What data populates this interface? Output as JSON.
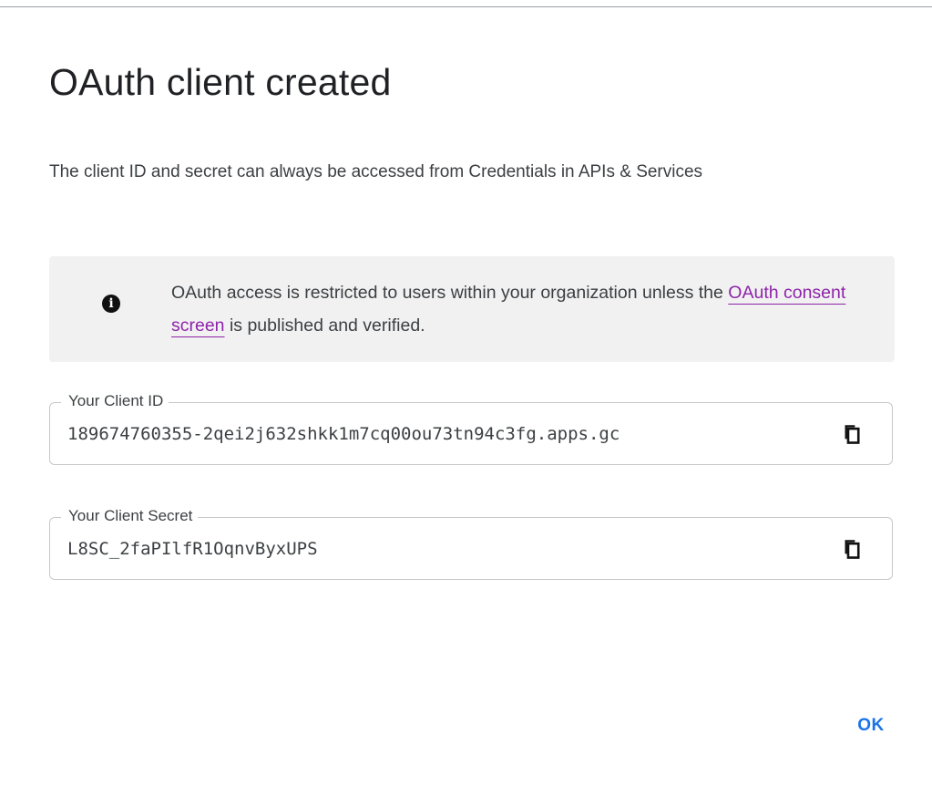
{
  "dialog": {
    "title": "OAuth client created",
    "description": "The client ID and secret can always be accessed from Credentials in APIs & Services",
    "notice": {
      "icon": "info-icon",
      "text_before": "OAuth access is restricted to users within your organization unless the ",
      "link_text": "OAuth consent screen",
      "text_after": " is published and verified."
    },
    "client_id": {
      "label": "Your Client ID",
      "value": "189674760355-2qei2j632shkk1m7cq00ou73tn94c3fg.apps.gc",
      "copy_icon": "copy-icon"
    },
    "client_secret": {
      "label": "Your Client Secret",
      "value": "L8SC_2faPIlfR1OqnvByxUPS",
      "copy_icon": "copy-icon"
    },
    "ok_label": "OK"
  },
  "colors": {
    "accent": "#1a73e8",
    "link": "#8e24aa",
    "notice_bg": "#f1f1f1",
    "text": "#202124"
  }
}
